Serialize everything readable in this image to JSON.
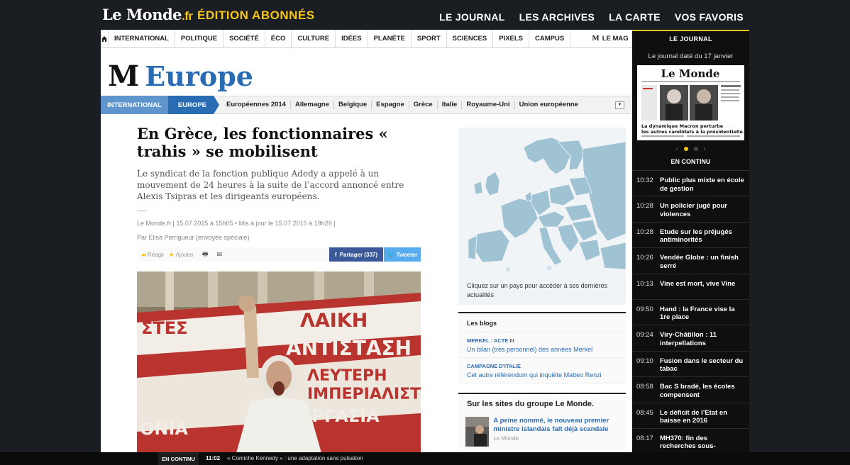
{
  "header": {
    "logo": "Le Monde",
    "logo_suffix": ".fr",
    "edition": "ÉDITION ABONNÉS",
    "nav": [
      "LE JOURNAL",
      "LES ARCHIVES",
      "LA CARTE",
      "VOS FAVORIS"
    ]
  },
  "rubriques": [
    "INTERNATIONAL",
    "POLITIQUE",
    "SOCIÉTÉ",
    "ÉCO",
    "CULTURE",
    "IDÉES",
    "PLANÈTE",
    "SPORT",
    "SCIENCES",
    "PIXELS",
    "CAMPUS"
  ],
  "rubrique_mag": "LE MAG",
  "section": {
    "logo_m": "M",
    "title": "Europe"
  },
  "subnav": {
    "parent": "INTERNATIONAL",
    "current": "EUROPE",
    "items": [
      "Européennes 2014",
      "Allemagne",
      "Belgique",
      "Espagne",
      "Grèce",
      "Italie",
      "Royaume-Uni",
      "Union européenne"
    ]
  },
  "article": {
    "title": "En Grèce, les fonctionnaires « trahis » se mobilisent",
    "chapo": "Le syndicat de la fonction publique Adedy a appelé à un mouvement de 24 heures à la suite de l’accord annoncé entre Alexis Tsipras et les dirigeants européens.",
    "meta": "Le Monde.fr | 15.07.2015 à 15h05 • Mis à jour le 15.07.2015 à 19h29 |",
    "author": "Par Elisa Perrigueur (envoyée spéciale)",
    "react": "Réagir",
    "add": "Ajouter",
    "share_fb": "Partager (337)",
    "share_tw": "Tweeter",
    "photo_banner_text": [
      "ΛΑΙΚΗ",
      "ΑΝΤΙΣΤΑΣΗ",
      "ΛΕΥΤΕΡΗ",
      "ΙΜΠΕΡΙΑΛΙΣΤ",
      "ΕΡΓΑΣΙΑ",
      "ΣΤΕΣ",
      "ΟΝΙΑ"
    ]
  },
  "map": {
    "caption": "Cliquez sur un pays pour accéder à ses dernières actualités"
  },
  "blogs": {
    "title": "Les blogs",
    "items": [
      {
        "kicker": "MERKEL : ACTE III",
        "text": "Un bilan (très personnel) des années Merkel"
      },
      {
        "kicker": "CAMPAGNE D’ITALIE",
        "text": "Cet autre référendum qui inquiète Matteo Renzi"
      }
    ]
  },
  "group": {
    "title": "Sur les sites du groupe Le Monde.",
    "item": {
      "text": "A peine nommé, le nouveau premier ministre islandais fait déjà scandale",
      "source": "Le Monde"
    }
  },
  "right": {
    "journal_title": "LE JOURNAL",
    "journal_date": "Le journal daté du 17 janvier",
    "front_logo": "Le Monde",
    "front_headline": "La dynamique Macron perturbe les autres candidats à la présidentielle",
    "continu_title": "EN CONTINU",
    "news": [
      {
        "time": "10:32",
        "text": "Public plus mixte en école de gestion"
      },
      {
        "time": "10:28",
        "text": "Un policier jugé pour violences"
      },
      {
        "time": "10:28",
        "text": "Etude sur les préjugés antiminorités"
      },
      {
        "time": "10:26",
        "text": "Vendée Globe : un finish serré"
      },
      {
        "time": "10:13",
        "text": "Vine est mort, vive Vine"
      },
      {
        "time": "09:50",
        "text": "Hand : la France vise la 1re place"
      },
      {
        "time": "09:24",
        "text": "Viry-Châtillon : 11 interpellations"
      },
      {
        "time": "09:10",
        "text": "Fusion dans le secteur du tabac"
      },
      {
        "time": "08:58",
        "text": "Bac S bradé, les écoles compensent"
      },
      {
        "time": "08:45",
        "text": "Le déficit de l’Etat en baisse en 2016"
      },
      {
        "time": "08:17",
        "text": "MH370: fin des recherches sous-"
      }
    ]
  },
  "ticker": {
    "label": "EN CONTINU",
    "time": "11:02",
    "text": "« Comiche Kennedy » : une adaptation sans pulsation"
  }
}
